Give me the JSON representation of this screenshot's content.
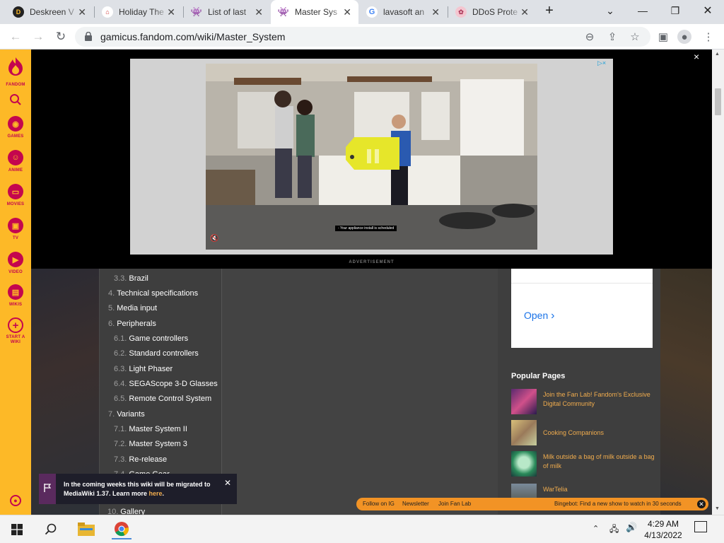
{
  "browser": {
    "tabs": [
      {
        "title": "Deskreen V",
        "icon": "deskreen-icon",
        "active": false
      },
      {
        "title": "Holiday The",
        "icon": "holiday-icon",
        "active": false
      },
      {
        "title": "List of last",
        "icon": "fandom-icon",
        "active": false
      },
      {
        "title": "Master Sys",
        "icon": "fandom-icon",
        "active": true
      },
      {
        "title": "lavasoft an",
        "icon": "google-icon",
        "active": false
      },
      {
        "title": "DDoS Prote",
        "icon": "ddos-icon",
        "active": false
      }
    ],
    "new_tab": "+",
    "address": "gamicus.fandom.com/wiki/Master_System"
  },
  "rail": {
    "logo": "FANDOM",
    "items": [
      {
        "label": "GAMES",
        "icon": "games-icon"
      },
      {
        "label": "ANIME",
        "icon": "anime-icon"
      },
      {
        "label": "MOVIES",
        "icon": "movies-icon"
      },
      {
        "label": "TV",
        "icon": "tv-icon"
      },
      {
        "label": "VIDEO",
        "icon": "video-icon"
      },
      {
        "label": "WIKIS",
        "icon": "wikis-icon"
      },
      {
        "label": "START A WIKI",
        "icon": "start-wiki-icon"
      }
    ]
  },
  "ad": {
    "subtitle": "- Your appliance install is scheduled",
    "label": "ADVERTISEMENT",
    "close": "×",
    "adchoices": "▷×"
  },
  "toc": [
    {
      "num": "3.3.",
      "label": "Brazil",
      "level": 2
    },
    {
      "num": "4.",
      "label": "Technical specifications",
      "level": 1
    },
    {
      "num": "5.",
      "label": "Media input",
      "level": 1
    },
    {
      "num": "6.",
      "label": "Peripherals",
      "level": 1
    },
    {
      "num": "6.1.",
      "label": "Game controllers",
      "level": 2
    },
    {
      "num": "6.2.",
      "label": "Standard controllers",
      "level": 2
    },
    {
      "num": "6.3.",
      "label": "Light Phaser",
      "level": 2
    },
    {
      "num": "6.4.",
      "label": "SEGAScope 3-D Glasses",
      "level": 2
    },
    {
      "num": "6.5.",
      "label": "Remote Control System",
      "level": 2
    },
    {
      "num": "7.",
      "label": "Variants",
      "level": 1
    },
    {
      "num": "7.1.",
      "label": "Master System II",
      "level": 2
    },
    {
      "num": "7.2.",
      "label": "Master System 3",
      "level": 2
    },
    {
      "num": "7.3.",
      "label": "Re-release",
      "level": 2
    },
    {
      "num": "7.4.",
      "label": "Game Gear",
      "level": 2
    }
  ],
  "gallery": {
    "num": "10.",
    "label": "Gallery"
  },
  "sidebar": {
    "open_label": "Open",
    "popular_title": "Popular Pages",
    "popular": [
      "Join the Fan Lab! Fandom's Exclusive Digital Community",
      "Cooking Companions",
      "Milk outside a bag of milk outside a bag of milk",
      "WarTelia"
    ]
  },
  "toast": {
    "text": "In the coming weeks this wiki will be migrated to MediaWiki 1.37. Learn more ",
    "link": "here",
    "end": "."
  },
  "footer": {
    "links": [
      "Follow on IG",
      "Newsletter",
      "Join Fan Lab"
    ],
    "promo": "Bingebot: Find a new show to watch in 30 seconds"
  },
  "taskbar": {
    "time": "4:29 AM",
    "date": "4/13/2022"
  },
  "colors": {
    "fandom_yellow": "#fdb927",
    "fandom_pink": "#c4064e",
    "link_orange": "#f0ac4e",
    "footer_orange": "#f29325"
  }
}
